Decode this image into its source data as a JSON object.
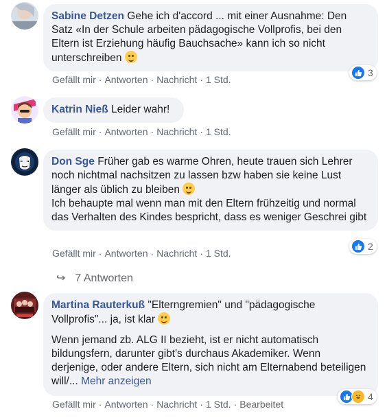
{
  "colors": {
    "name": "#385898",
    "bubble": "#f0f2f5",
    "meta": "#65676b",
    "like": "#1877f2"
  },
  "comments": [
    {
      "author": "Sabine Detzen",
      "text": "Gehe ich d'accord ... mit einer Ausnahme: Den Satz «In der Schule arbeiten pädagogische Vollprofis, bei den Eltern ist Erziehung häufig Bauchsache» kann ich so nicht unterschreiben",
      "emoji": "smiling-face",
      "actions": {
        "like": "Gefällt mir",
        "reply": "Antworten",
        "message": "Nachricht",
        "time": "1 Std."
      },
      "reactions": {
        "count": "3",
        "icons": [
          "like-icon"
        ]
      }
    },
    {
      "author": "Katrin Nieß",
      "text": "Leider wahr!",
      "actions": {
        "like": "Gefällt mir",
        "reply": "Antworten",
        "message": "Nachricht",
        "time": "1 Std."
      }
    },
    {
      "author": "Don Sge",
      "text": "Früher gab es warme Ohren, heute trauen sich Lehrer noch nichtmal nachsitzen zu lassen bzw haben sie keine Lust länger als üblich zu bleiben",
      "emoji": "winking-tongue-face",
      "text2": "Ich behaupte mal wenn man mit den Eltern frühzeitig und normal das Verhalten des Kindes bespricht, dass es weniger Geschrei gibt",
      "actions": {
        "like": "Gefällt mir",
        "reply": "Antworten",
        "message": "Nachricht",
        "time": "1 Std."
      },
      "reactions": {
        "count": "2",
        "icons": [
          "like-icon"
        ]
      },
      "replies_label": "7 Antworten"
    },
    {
      "author": "Martina Rauterkuß",
      "text": "\"Elterngremien\" und \"pädagogische Vollprofis\"... ja, ist klar",
      "emoji": "rolling-laughing-face",
      "text2": "Wenn jemand zb. ALG II bezieht, ist er nicht automatisch bildungsfern, darunter gibt's durchaus Akademiker. Wenn derjenige, oder andere Eltern, sich nicht am Elternabend beteiligen will/...",
      "more": "Mehr anzeigen",
      "actions": {
        "like": "Gefällt mir",
        "reply": "Antworten",
        "message": "Nachricht",
        "time": "1 Std.",
        "edited": "Bearbeitet"
      },
      "reactions": {
        "count": "4",
        "icons": [
          "like-icon",
          "haha-icon"
        ]
      }
    }
  ]
}
